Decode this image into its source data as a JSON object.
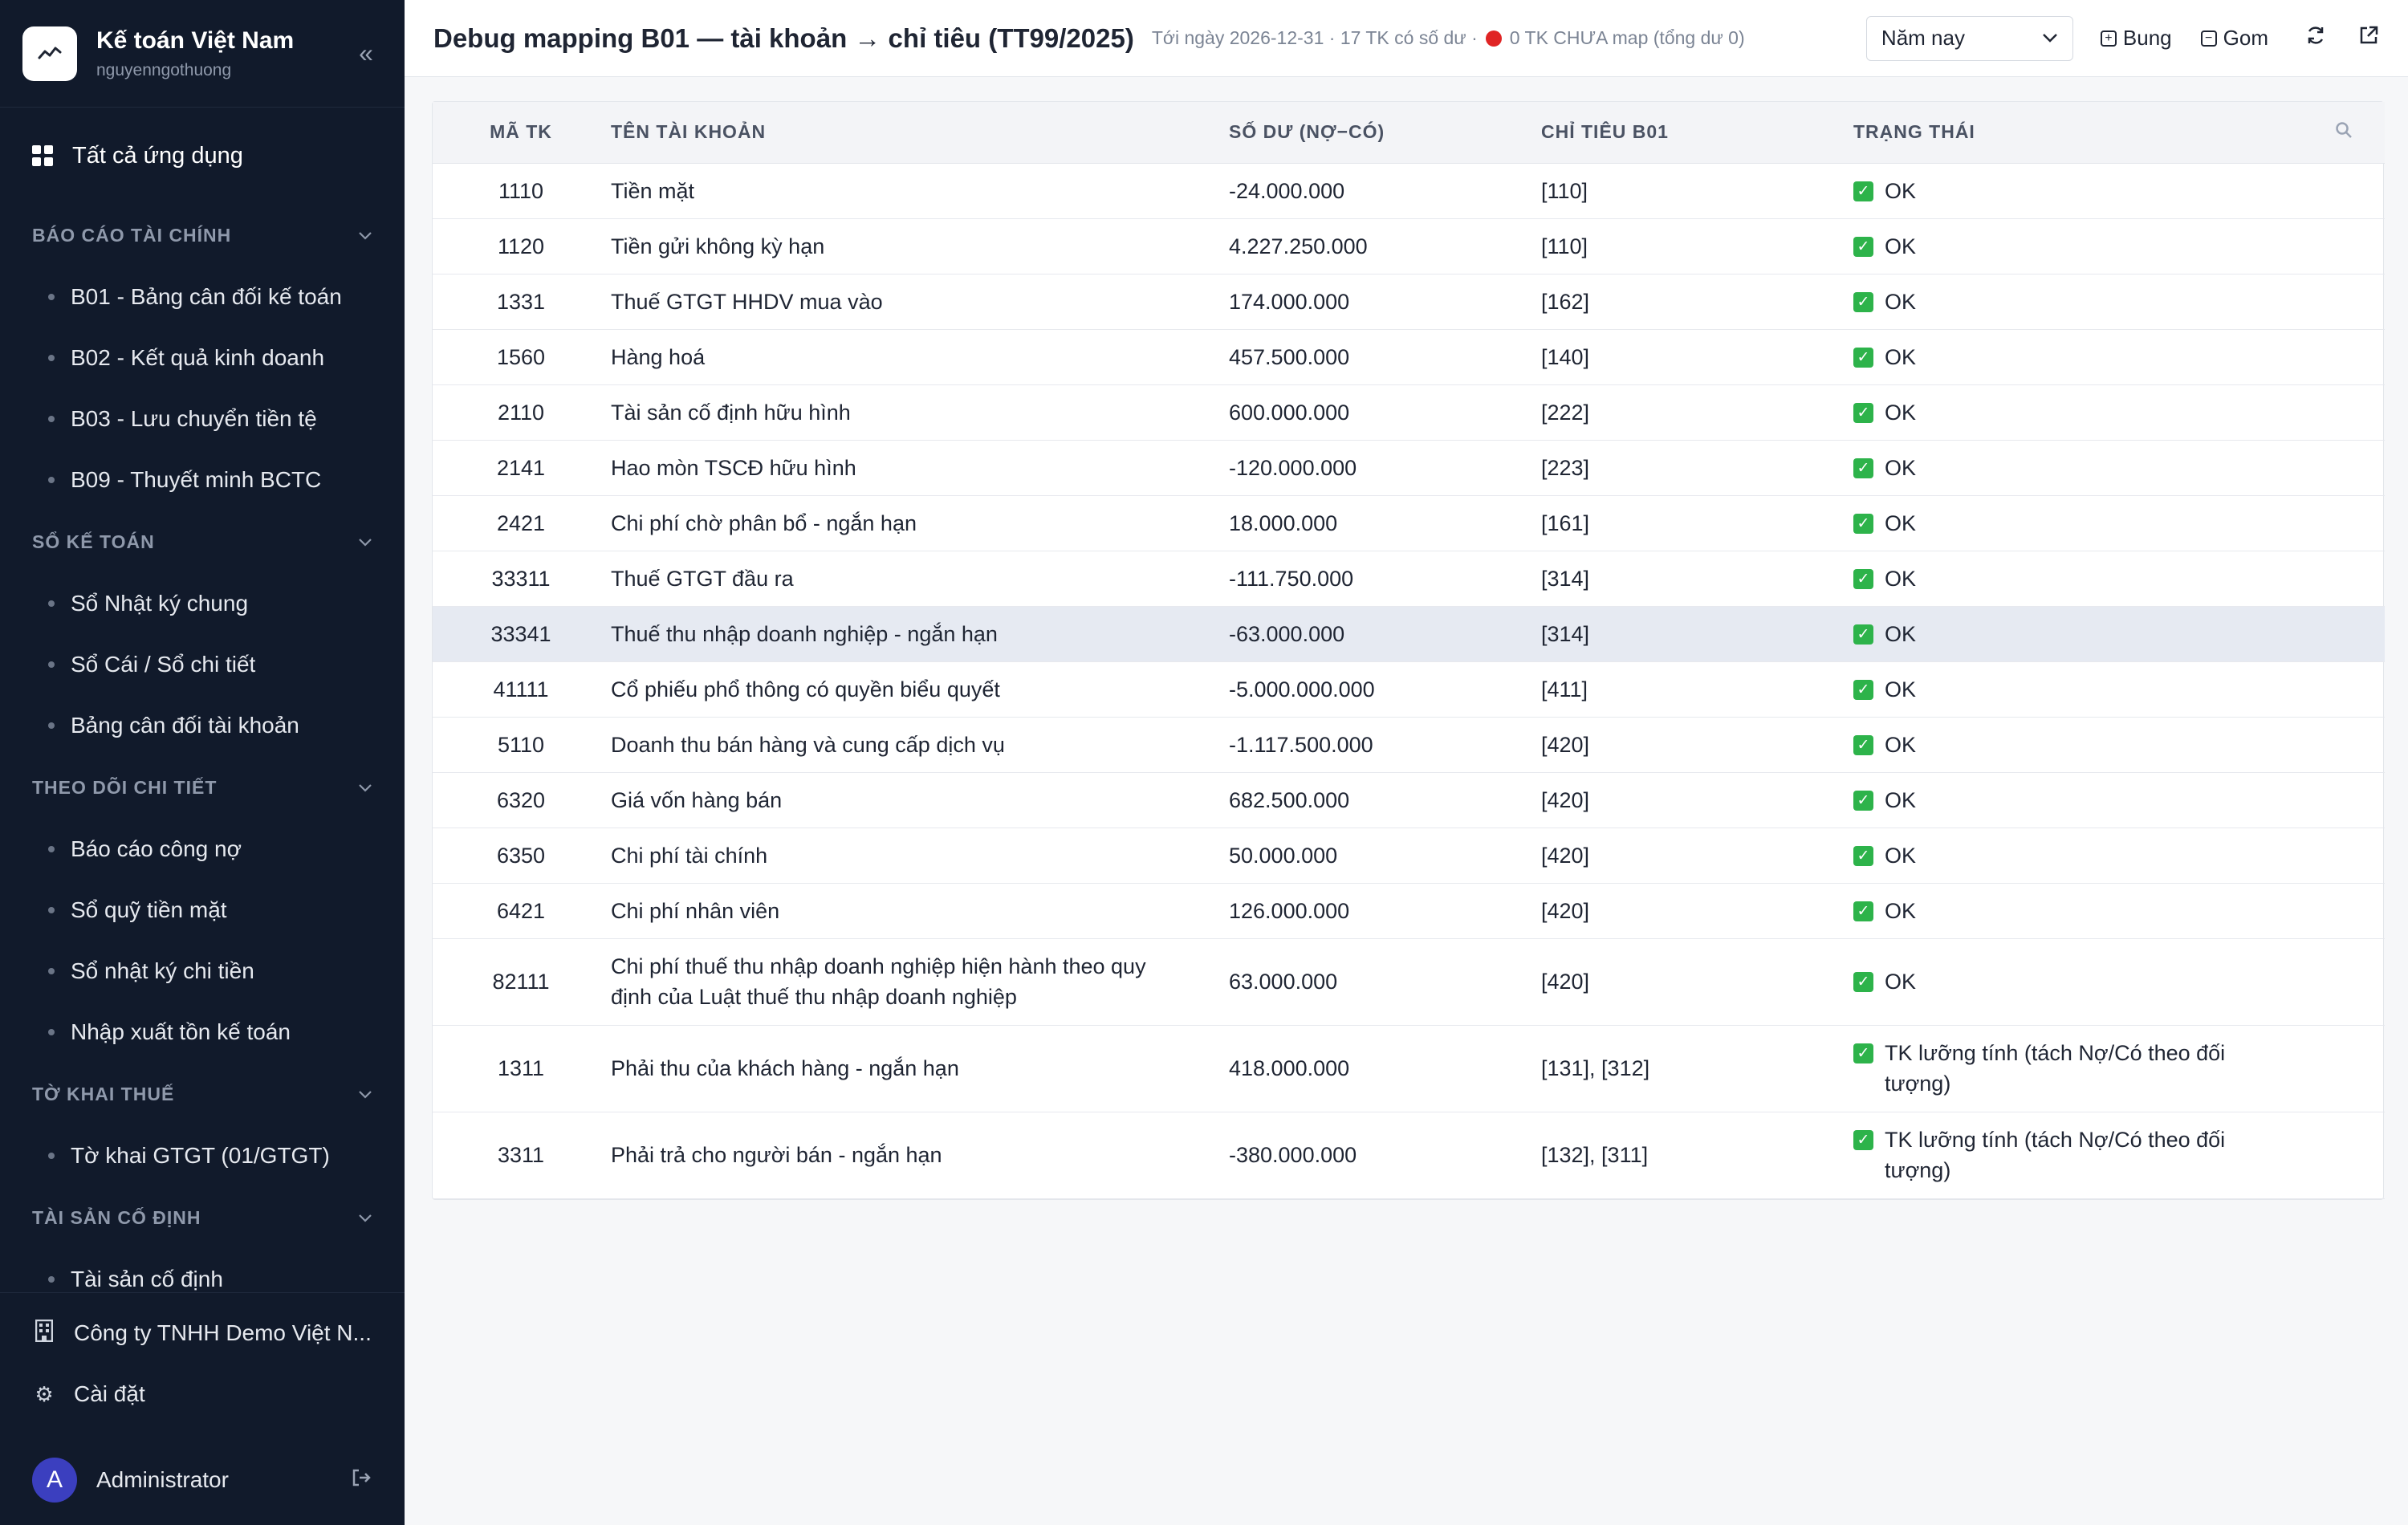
{
  "app": {
    "name": "Kế toán Việt Nam",
    "user": "nguyenngothuong",
    "all_apps_label": "Tất cả ứng dụng"
  },
  "sidebar": {
    "sections": [
      {
        "title": "BÁO CÁO TÀI CHÍNH",
        "items": [
          "B01 - Bảng cân đối kế toán",
          "B02 - Kết quả kinh doanh",
          "B03 - Lưu chuyển tiền tệ",
          "B09 - Thuyết minh BCTC"
        ]
      },
      {
        "title": "SỔ KẾ TOÁN",
        "items": [
          "Sổ Nhật ký chung",
          "Sổ Cái / Sổ chi tiết",
          "Bảng cân đối tài khoản"
        ]
      },
      {
        "title": "THEO DÕI CHI TIẾT",
        "items": [
          "Báo cáo công nợ",
          "Sổ quỹ tiền mặt",
          "Sổ nhật ký chi tiền",
          "Nhập xuất tồn kế toán"
        ]
      },
      {
        "title": "TỜ KHAI THUẾ",
        "items": [
          "Tờ khai GTGT (01/GTGT)"
        ]
      },
      {
        "title": "TÀI SẢN CỐ ĐỊNH",
        "items": [
          "Tài sản cố định"
        ]
      }
    ],
    "company": "Công ty TNHH Demo Việt N...",
    "settings_label": "Cài đặt",
    "user_name": "Administrator",
    "user_initial": "A"
  },
  "header": {
    "title": "Debug mapping B01 — tài khoản → chỉ tiêu (TT99/2025)",
    "subtitle_left": "Tới ngày 2026-12-31 · 17 TK có số dư ·",
    "subtitle_right": "0 TK CHƯA map (tổng dư 0)",
    "period_select": "Năm nay",
    "expand_label": "Bung",
    "collapse_label": "Gom"
  },
  "table": {
    "columns": [
      "MÃ TK",
      "TÊN TÀI KHOẢN",
      "SỐ DƯ (NỢ−CÓ)",
      "CHỈ TIÊU B01",
      "TRẠNG THÁI"
    ],
    "rows": [
      {
        "code": "1110",
        "name": "Tiền mặt",
        "balance": "-24.000.000",
        "target": "[110]",
        "status": "OK"
      },
      {
        "code": "1120",
        "name": "Tiền gửi không kỳ hạn",
        "balance": "4.227.250.000",
        "target": "[110]",
        "status": "OK"
      },
      {
        "code": "1331",
        "name": "Thuế GTGT HHDV mua vào",
        "balance": "174.000.000",
        "target": "[162]",
        "status": "OK"
      },
      {
        "code": "1560",
        "name": "Hàng hoá",
        "balance": "457.500.000",
        "target": "[140]",
        "status": "OK"
      },
      {
        "code": "2110",
        "name": "Tài sản cố định hữu hình",
        "balance": "600.000.000",
        "target": "[222]",
        "status": "OK"
      },
      {
        "code": "2141",
        "name": "Hao mòn TSCĐ hữu hình",
        "balance": "-120.000.000",
        "target": "[223]",
        "status": "OK"
      },
      {
        "code": "2421",
        "name": "Chi phí chờ phân bổ - ngắn hạn",
        "balance": "18.000.000",
        "target": "[161]",
        "status": "OK"
      },
      {
        "code": "33311",
        "name": "Thuế GTGT đầu ra",
        "balance": "-111.750.000",
        "target": "[314]",
        "status": "OK"
      },
      {
        "code": "33341",
        "name": "Thuế thu nhập doanh nghiệp - ngắn hạn",
        "balance": "-63.000.000",
        "target": "[314]",
        "status": "OK"
      },
      {
        "code": "41111",
        "name": "Cổ phiếu phổ thông có quyền biểu quyết",
        "balance": "-5.000.000.000",
        "target": "[411]",
        "status": "OK"
      },
      {
        "code": "5110",
        "name": "Doanh thu bán hàng và cung cấp dịch vụ",
        "balance": "-1.117.500.000",
        "target": "[420]",
        "status": "OK"
      },
      {
        "code": "6320",
        "name": "Giá vốn hàng bán",
        "balance": "682.500.000",
        "target": "[420]",
        "status": "OK"
      },
      {
        "code": "6350",
        "name": "Chi phí tài chính",
        "balance": "50.000.000",
        "target": "[420]",
        "status": "OK"
      },
      {
        "code": "6421",
        "name": "Chi phí nhân viên",
        "balance": "126.000.000",
        "target": "[420]",
        "status": "OK"
      },
      {
        "code": "82111",
        "name": "Chi phí thuế thu nhập doanh nghiệp hiện hành theo quy định của Luật thuế thu nhập doanh nghiệp",
        "balance": "63.000.000",
        "target": "[420]",
        "status": "OK"
      },
      {
        "code": "1311",
        "name": "Phải thu của khách hàng - ngắn hạn",
        "balance": "418.000.000",
        "target": "[131], [312]",
        "status": "TK lưỡng tính (tách Nợ/Có theo đối tượng)"
      },
      {
        "code": "3311",
        "name": "Phải trả cho người bán - ngắn hạn",
        "balance": "-380.000.000",
        "target": "[132], [311]",
        "status": "TK lưỡng tính (tách Nợ/Có theo đối tượng)"
      }
    ]
  },
  "colors": {
    "sidebar_bg": "#111a2b",
    "ok_check": "#2db34a",
    "alert_dot": "#e02424",
    "avatar": "#3b3fbf",
    "row_highlight": "#e6eaf2"
  }
}
